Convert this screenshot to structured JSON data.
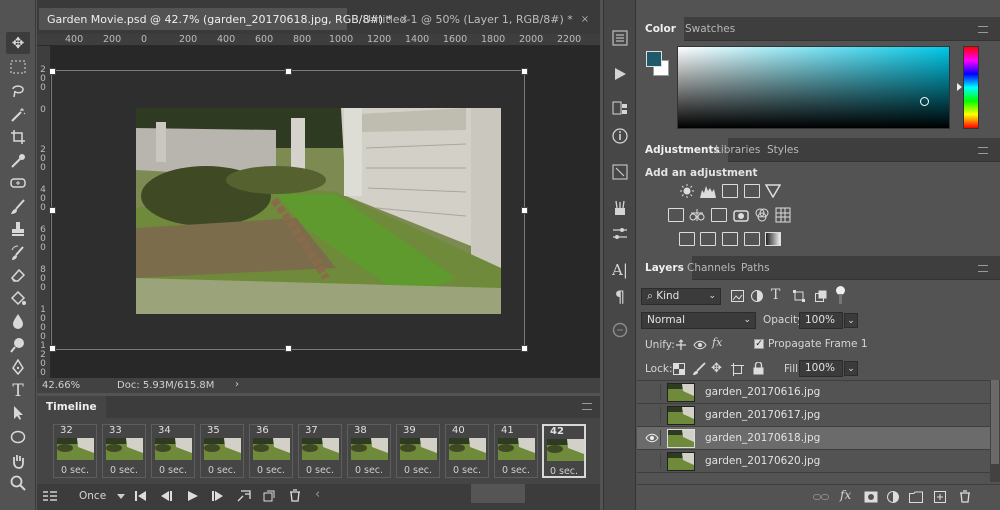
{
  "document_tabs": [
    {
      "label": "Garden Movie.psd @ 42.7% (garden_20170618.jpg, RGB/8#) *",
      "close": "×"
    },
    {
      "label": "Untitled-1 @ 50% (Layer 1, RGB/8#) *",
      "close": "×"
    }
  ],
  "ruler": {
    "h_ticks": [
      "400",
      "200",
      "0",
      "200",
      "400",
      "600",
      "800",
      "1000",
      "1200",
      "1400",
      "1600",
      "1800",
      "2000",
      "2200"
    ],
    "v_ticks": [
      "2\n0\n0",
      "0",
      "2\n0\n0",
      "4\n0\n0",
      "6\n0\n0",
      "8\n0\n0",
      "1\n0\n0\n0",
      "1\n2\n0\n0"
    ]
  },
  "status": {
    "zoom": "42.66%",
    "doc": "Doc: 5.93M/615.8M",
    "arrow": "›"
  },
  "timeline": {
    "title": "Timeline",
    "frames": [
      {
        "num": "32",
        "dur": "0 sec."
      },
      {
        "num": "33",
        "dur": "0 sec."
      },
      {
        "num": "34",
        "dur": "0 sec."
      },
      {
        "num": "35",
        "dur": "0 sec."
      },
      {
        "num": "36",
        "dur": "0 sec."
      },
      {
        "num": "37",
        "dur": "0 sec."
      },
      {
        "num": "38",
        "dur": "0 sec."
      },
      {
        "num": "39",
        "dur": "0 sec."
      },
      {
        "num": "40",
        "dur": "0 sec."
      },
      {
        "num": "41",
        "dur": "0 sec."
      },
      {
        "num": "42",
        "dur": "0 sec."
      }
    ],
    "loop": "Once"
  },
  "color_panel": {
    "tabs": [
      "Color",
      "Swatches"
    ],
    "foreground": "#1f5a6a"
  },
  "adjustments_panel": {
    "tabs": [
      "Adjustments",
      "Libraries",
      "Styles"
    ],
    "heading": "Add an adjustment"
  },
  "layers_panel": {
    "tabs": [
      "Layers",
      "Channels",
      "Paths"
    ],
    "filter": "Kind",
    "blend_mode": "Normal",
    "opacity_label": "Opacity:",
    "opacity": "100%",
    "unify_label": "Unify:",
    "propagate": "Propagate Frame 1",
    "lock_label": "Lock:",
    "fill_label": "Fill:",
    "fill": "100%",
    "layers": [
      {
        "name": "garden_20170616.jpg",
        "visible": false
      },
      {
        "name": "garden_20170617.jpg",
        "visible": false
      },
      {
        "name": "garden_20170618.jpg",
        "visible": true
      },
      {
        "name": "garden_20170620.jpg",
        "visible": false
      }
    ]
  },
  "colors": {
    "accent": "#1f5a6a",
    "panel": "#535353",
    "canvas": "#282828"
  }
}
